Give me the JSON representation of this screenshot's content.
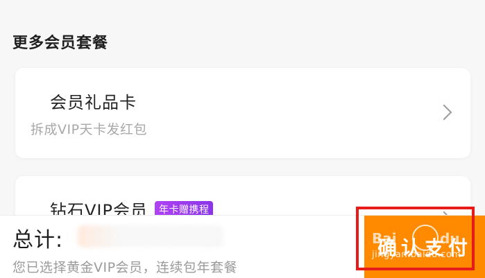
{
  "section": {
    "title": "更多会员套餐"
  },
  "cards": [
    {
      "title": "会员礼品卡",
      "subtitle": "拆成VIP天卡发红包"
    },
    {
      "title": "钻石VIP会员",
      "tag": "年卡赠携程"
    }
  ],
  "footer": {
    "total_label": "总计:",
    "note": "您已选择黄金VIP会员，连续包年套餐",
    "pay_button_label": "确认支付"
  },
  "watermark": {
    "site": "jingyan.baidu.com",
    "bai": "Bai",
    "du": "du"
  },
  "colors": {
    "pay_button": "#ff8a00",
    "tag_bg": "#9b3cf0",
    "highlight": "#e81b1b"
  }
}
